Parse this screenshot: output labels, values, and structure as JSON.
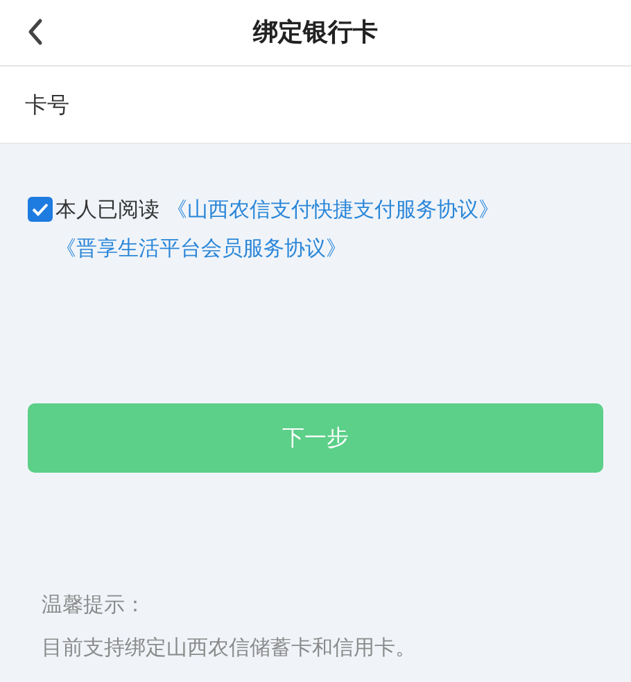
{
  "header": {
    "title": "绑定银行卡"
  },
  "card_field": {
    "label": "卡号"
  },
  "agreement": {
    "checked": true,
    "text": "本人已阅读",
    "links": [
      "《山西农信支付快捷支付服务协议》",
      "《晋享生活平台会员服务协议》"
    ]
  },
  "next_button": {
    "label": "下一步"
  },
  "tips": {
    "title": "温馨提示：",
    "text": "目前支持绑定山西农信储蓄卡和信用卡。"
  }
}
